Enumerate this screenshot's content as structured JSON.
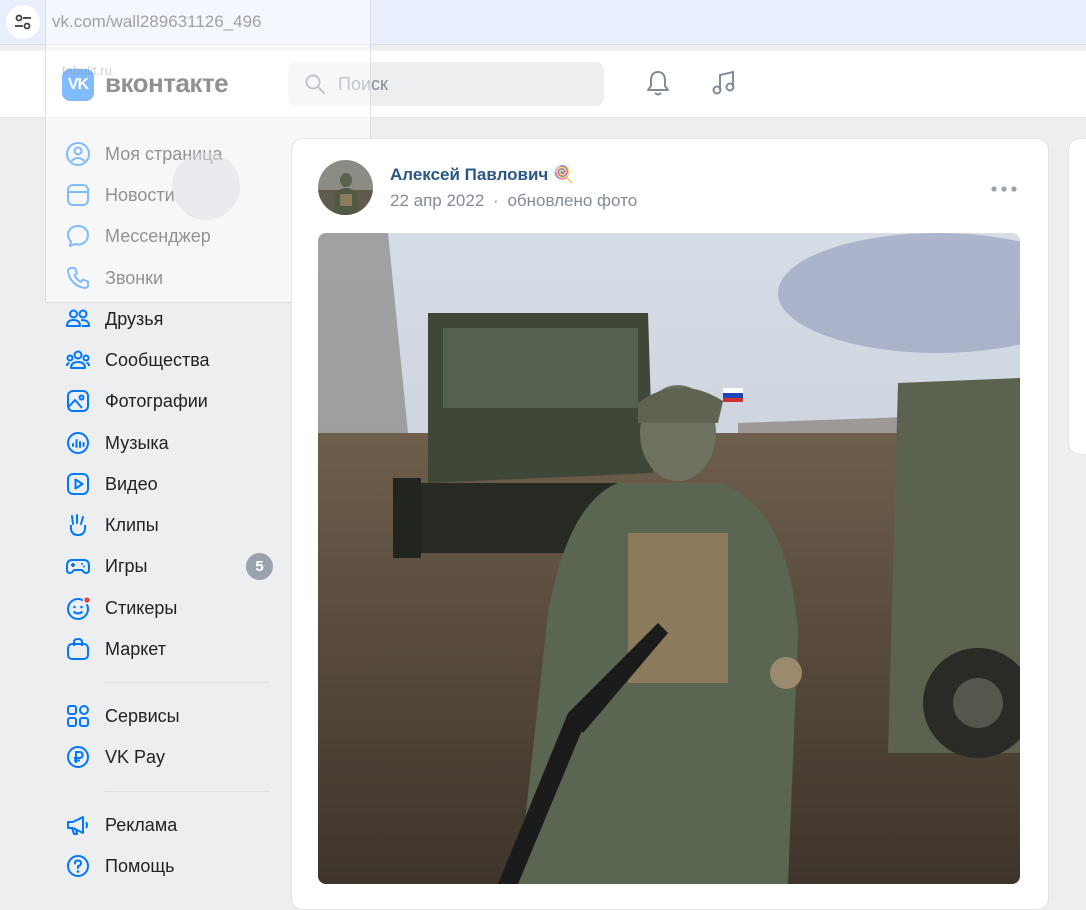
{
  "browser": {
    "url": "vk.com/wall289631126_496",
    "site_info_icon": "tune-icon"
  },
  "header": {
    "brand": "вконтакте",
    "logo_text": "VK",
    "search_placeholder": "Поиск",
    "accent": "#0077ff"
  },
  "overlay": {
    "faint_text": "tabulit.ru"
  },
  "sidebar": {
    "items": [
      {
        "label": "Моя страница",
        "icon": "profile-icon"
      },
      {
        "label": "Новости",
        "icon": "news-icon"
      },
      {
        "label": "Мессенджер",
        "icon": "messenger-icon"
      },
      {
        "label": "Звонки",
        "icon": "phone-icon"
      },
      {
        "label": "Друзья",
        "icon": "friends-icon"
      },
      {
        "label": "Сообщества",
        "icon": "communities-icon"
      },
      {
        "label": "Фотографии",
        "icon": "photos-icon"
      },
      {
        "label": "Музыка",
        "icon": "music-icon"
      },
      {
        "label": "Видео",
        "icon": "video-icon"
      },
      {
        "label": "Клипы",
        "icon": "clips-icon"
      },
      {
        "label": "Игры",
        "icon": "games-icon",
        "badge": "5"
      },
      {
        "label": "Стикеры",
        "icon": "stickers-icon"
      },
      {
        "label": "Маркет",
        "icon": "market-icon"
      },
      {
        "label": "Сервисы",
        "icon": "services-icon"
      },
      {
        "label": "VK Pay",
        "icon": "vkpay-icon"
      },
      {
        "label": "Реклама",
        "icon": "ads-icon"
      },
      {
        "label": "Помощь",
        "icon": "help-icon"
      }
    ]
  },
  "post": {
    "author": "Алексей Павлович",
    "author_emoji": "🍭",
    "date": "22 апр 2022",
    "separator": "·",
    "action": "обновлено фото",
    "more_icon": "more-dots-icon"
  }
}
